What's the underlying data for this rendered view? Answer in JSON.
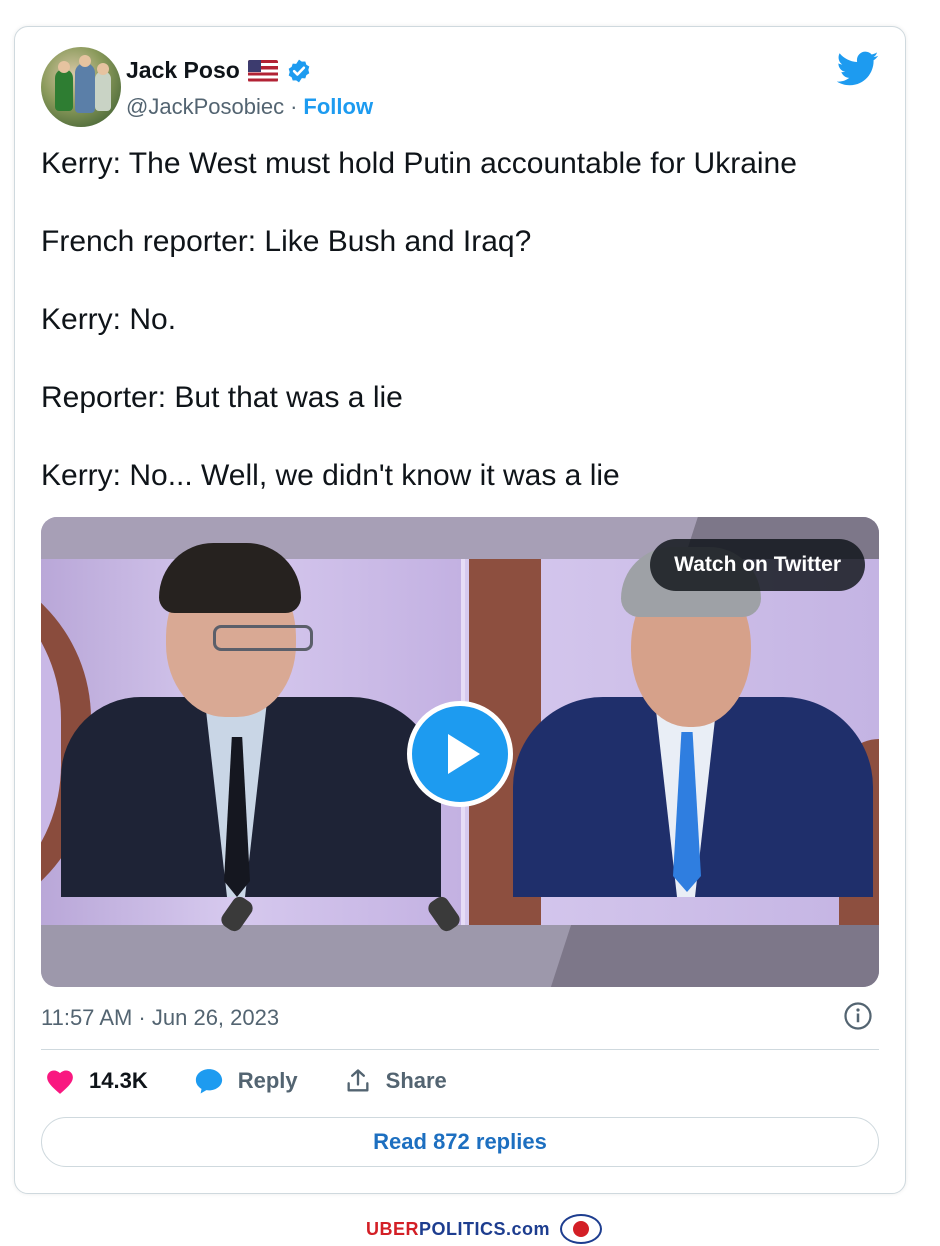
{
  "tweet": {
    "author_name": "Jack Poso",
    "flag_icon": "us-flag-icon",
    "verified_icon": "verified-badge-icon",
    "handle": "@JackPosobiec",
    "separator": "·",
    "follow_label": "Follow",
    "logo_icon": "twitter-bird-icon",
    "lines": [
      "Kerry: The West must hold Putin accountable for Ukraine",
      "French reporter: Like Bush and Iraq?",
      "Kerry: No.",
      "Reporter: But that was a lie",
      "Kerry: No... Well, we didn't know it was a lie"
    ],
    "media": {
      "watch_label": "Watch on Twitter",
      "play_icon": "play-icon"
    },
    "timestamp": "11:57 AM · Jun 26, 2023",
    "info_icon": "info-icon",
    "actions": {
      "likes": "14.3K",
      "reply_label": "Reply",
      "share_label": "Share"
    },
    "read_replies_label": "Read 872 replies"
  },
  "footer": {
    "brand_part1": "UBER",
    "brand_part2": "POLITICS.com"
  },
  "colors": {
    "accent": "#1d9bf0",
    "like": "#f91880",
    "text": "#0f1419",
    "secondary": "#536471",
    "brand_red": "#d31f26",
    "brand_blue": "#1d3d8f"
  }
}
